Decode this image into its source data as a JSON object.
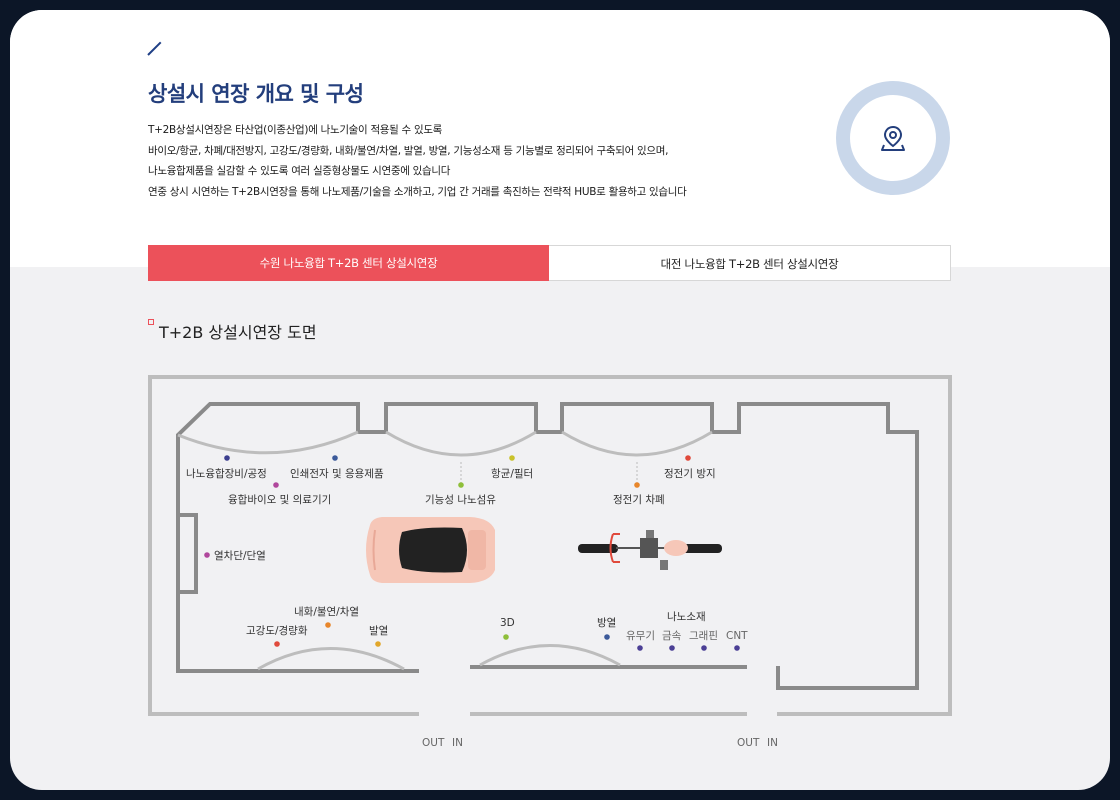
{
  "header": {
    "title": "상설시 연장 개요 및 구성",
    "description": [
      "T+2B상설시연장은 타산업(이종산업)에 나노기술이 적용될 수 있도록",
      "바이오/항균, 차폐/대전방지, 고강도/경량화, 내화/불연/차열, 발열, 방열, 기능성소재 등 기능별로 정리되어 구축되어 있으며,",
      "나노융합제품을 실감할 수 있도록 여러 실증형상물도 시연중에 있습니다",
      "연중 상시 시연하는 T+2B시연장을 통해 나노제품/기술을 소개하고, 기업 간 거래를 촉진하는 전략적 HUB로 활용하고 있습니다"
    ],
    "icon": "location-pin-icon"
  },
  "tabs": [
    {
      "label": "수원 나노융합 T+2B 센터 상설시연장",
      "active": true
    },
    {
      "label": "대전 나노융합 T+2B 센터 상설시연장",
      "active": false
    }
  ],
  "section": {
    "title": "T+2B 상설시연장 도면"
  },
  "floorplan": {
    "labels": {
      "nano_equipment": "나노융합장비/공정",
      "printed_electronics": "인쇄전자 및 응용제품",
      "antibacterial_filter": "항균/필터",
      "static_prevention": "정전기 방지",
      "bio_medical": "융합바이오 및 의료기기",
      "functional_fiber": "기능성 나노섬유",
      "static_shielding": "정전기 차폐",
      "heat_insulation": "열차단/단열",
      "fire_resistant": "내화/불연/차열",
      "high_strength": "고강도/경량화",
      "heating": "발열",
      "three_d": "3D",
      "heat_dissipation": "방열",
      "nano_materials": "나노소재",
      "organic_inorganic": "유무기",
      "metal": "금속",
      "graphene": "그래핀",
      "cnt": "CNT",
      "out1": "OUT",
      "in1": "IN",
      "out2": "OUT",
      "in2": "IN"
    },
    "dot_colors": {
      "navy": "#3d3f8f",
      "magenta": "#b0479c",
      "yellow": "#c9c22b",
      "red": "#e04a3c",
      "orange": "#e8862a",
      "green": "#8fbf3a",
      "purple": "#4b3f95",
      "gold": "#e2a72a",
      "blue": "#3c5a9a"
    }
  },
  "colors": {
    "accent": "#ec515a",
    "title": "#233e7c",
    "wall": "#8a8a8a",
    "outer_wall": "#bdbdbd"
  }
}
